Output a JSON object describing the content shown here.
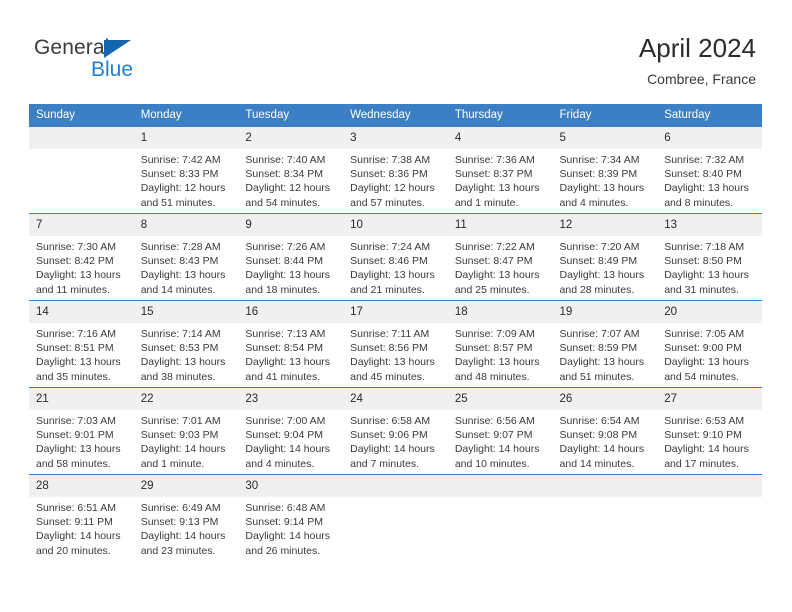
{
  "brand": {
    "word_one": "General",
    "word_two": "Blue",
    "triangle_icon": "triangle-icon",
    "accent_blue": "#1f7fd0",
    "triangle_blue": "#1565b0"
  },
  "header": {
    "title": "April 2024",
    "subtitle": "Combree, France"
  },
  "theme": {
    "header_blue": "#3b7fc4",
    "daynum_bg": "#f0f0f0",
    "text": "#3a3a3a"
  },
  "columns": [
    "Sunday",
    "Monday",
    "Tuesday",
    "Wednesday",
    "Thursday",
    "Friday",
    "Saturday"
  ],
  "labels": {
    "sunrise": "Sunrise:",
    "sunset": "Sunset:",
    "daylight": "Daylight:"
  },
  "weeks": [
    [
      {
        "day": "",
        "sunrise": "",
        "sunset": "",
        "daylight1": "",
        "daylight2": "",
        "empty": true
      },
      {
        "day": "1",
        "sunrise": "Sunrise: 7:42 AM",
        "sunset": "Sunset: 8:33 PM",
        "daylight1": "Daylight: 12 hours",
        "daylight2": "and 51 minutes."
      },
      {
        "day": "2",
        "sunrise": "Sunrise: 7:40 AM",
        "sunset": "Sunset: 8:34 PM",
        "daylight1": "Daylight: 12 hours",
        "daylight2": "and 54 minutes."
      },
      {
        "day": "3",
        "sunrise": "Sunrise: 7:38 AM",
        "sunset": "Sunset: 8:36 PM",
        "daylight1": "Daylight: 12 hours",
        "daylight2": "and 57 minutes."
      },
      {
        "day": "4",
        "sunrise": "Sunrise: 7:36 AM",
        "sunset": "Sunset: 8:37 PM",
        "daylight1": "Daylight: 13 hours",
        "daylight2": "and 1 minute."
      },
      {
        "day": "5",
        "sunrise": "Sunrise: 7:34 AM",
        "sunset": "Sunset: 8:39 PM",
        "daylight1": "Daylight: 13 hours",
        "daylight2": "and 4 minutes."
      },
      {
        "day": "6",
        "sunrise": "Sunrise: 7:32 AM",
        "sunset": "Sunset: 8:40 PM",
        "daylight1": "Daylight: 13 hours",
        "daylight2": "and 8 minutes."
      }
    ],
    [
      {
        "day": "7",
        "sunrise": "Sunrise: 7:30 AM",
        "sunset": "Sunset: 8:42 PM",
        "daylight1": "Daylight: 13 hours",
        "daylight2": "and 11 minutes."
      },
      {
        "day": "8",
        "sunrise": "Sunrise: 7:28 AM",
        "sunset": "Sunset: 8:43 PM",
        "daylight1": "Daylight: 13 hours",
        "daylight2": "and 14 minutes."
      },
      {
        "day": "9",
        "sunrise": "Sunrise: 7:26 AM",
        "sunset": "Sunset: 8:44 PM",
        "daylight1": "Daylight: 13 hours",
        "daylight2": "and 18 minutes."
      },
      {
        "day": "10",
        "sunrise": "Sunrise: 7:24 AM",
        "sunset": "Sunset: 8:46 PM",
        "daylight1": "Daylight: 13 hours",
        "daylight2": "and 21 minutes."
      },
      {
        "day": "11",
        "sunrise": "Sunrise: 7:22 AM",
        "sunset": "Sunset: 8:47 PM",
        "daylight1": "Daylight: 13 hours",
        "daylight2": "and 25 minutes."
      },
      {
        "day": "12",
        "sunrise": "Sunrise: 7:20 AM",
        "sunset": "Sunset: 8:49 PM",
        "daylight1": "Daylight: 13 hours",
        "daylight2": "and 28 minutes."
      },
      {
        "day": "13",
        "sunrise": "Sunrise: 7:18 AM",
        "sunset": "Sunset: 8:50 PM",
        "daylight1": "Daylight: 13 hours",
        "daylight2": "and 31 minutes."
      }
    ],
    [
      {
        "day": "14",
        "sunrise": "Sunrise: 7:16 AM",
        "sunset": "Sunset: 8:51 PM",
        "daylight1": "Daylight: 13 hours",
        "daylight2": "and 35 minutes."
      },
      {
        "day": "15",
        "sunrise": "Sunrise: 7:14 AM",
        "sunset": "Sunset: 8:53 PM",
        "daylight1": "Daylight: 13 hours",
        "daylight2": "and 38 minutes."
      },
      {
        "day": "16",
        "sunrise": "Sunrise: 7:13 AM",
        "sunset": "Sunset: 8:54 PM",
        "daylight1": "Daylight: 13 hours",
        "daylight2": "and 41 minutes."
      },
      {
        "day": "17",
        "sunrise": "Sunrise: 7:11 AM",
        "sunset": "Sunset: 8:56 PM",
        "daylight1": "Daylight: 13 hours",
        "daylight2": "and 45 minutes."
      },
      {
        "day": "18",
        "sunrise": "Sunrise: 7:09 AM",
        "sunset": "Sunset: 8:57 PM",
        "daylight1": "Daylight: 13 hours",
        "daylight2": "and 48 minutes."
      },
      {
        "day": "19",
        "sunrise": "Sunrise: 7:07 AM",
        "sunset": "Sunset: 8:59 PM",
        "daylight1": "Daylight: 13 hours",
        "daylight2": "and 51 minutes."
      },
      {
        "day": "20",
        "sunrise": "Sunrise: 7:05 AM",
        "sunset": "Sunset: 9:00 PM",
        "daylight1": "Daylight: 13 hours",
        "daylight2": "and 54 minutes."
      }
    ],
    [
      {
        "day": "21",
        "sunrise": "Sunrise: 7:03 AM",
        "sunset": "Sunset: 9:01 PM",
        "daylight1": "Daylight: 13 hours",
        "daylight2": "and 58 minutes."
      },
      {
        "day": "22",
        "sunrise": "Sunrise: 7:01 AM",
        "sunset": "Sunset: 9:03 PM",
        "daylight1": "Daylight: 14 hours",
        "daylight2": "and 1 minute."
      },
      {
        "day": "23",
        "sunrise": "Sunrise: 7:00 AM",
        "sunset": "Sunset: 9:04 PM",
        "daylight1": "Daylight: 14 hours",
        "daylight2": "and 4 minutes."
      },
      {
        "day": "24",
        "sunrise": "Sunrise: 6:58 AM",
        "sunset": "Sunset: 9:06 PM",
        "daylight1": "Daylight: 14 hours",
        "daylight2": "and 7 minutes."
      },
      {
        "day": "25",
        "sunrise": "Sunrise: 6:56 AM",
        "sunset": "Sunset: 9:07 PM",
        "daylight1": "Daylight: 14 hours",
        "daylight2": "and 10 minutes."
      },
      {
        "day": "26",
        "sunrise": "Sunrise: 6:54 AM",
        "sunset": "Sunset: 9:08 PM",
        "daylight1": "Daylight: 14 hours",
        "daylight2": "and 14 minutes."
      },
      {
        "day": "27",
        "sunrise": "Sunrise: 6:53 AM",
        "sunset": "Sunset: 9:10 PM",
        "daylight1": "Daylight: 14 hours",
        "daylight2": "and 17 minutes."
      }
    ],
    [
      {
        "day": "28",
        "sunrise": "Sunrise: 6:51 AM",
        "sunset": "Sunset: 9:11 PM",
        "daylight1": "Daylight: 14 hours",
        "daylight2": "and 20 minutes."
      },
      {
        "day": "29",
        "sunrise": "Sunrise: 6:49 AM",
        "sunset": "Sunset: 9:13 PM",
        "daylight1": "Daylight: 14 hours",
        "daylight2": "and 23 minutes."
      },
      {
        "day": "30",
        "sunrise": "Sunrise: 6:48 AM",
        "sunset": "Sunset: 9:14 PM",
        "daylight1": "Daylight: 14 hours",
        "daylight2": "and 26 minutes."
      },
      {
        "day": "",
        "sunrise": "",
        "sunset": "",
        "daylight1": "",
        "daylight2": "",
        "empty": true
      },
      {
        "day": "",
        "sunrise": "",
        "sunset": "",
        "daylight1": "",
        "daylight2": "",
        "empty": true
      },
      {
        "day": "",
        "sunrise": "",
        "sunset": "",
        "daylight1": "",
        "daylight2": "",
        "empty": true
      },
      {
        "day": "",
        "sunrise": "",
        "sunset": "",
        "daylight1": "",
        "daylight2": "",
        "empty": true
      }
    ]
  ]
}
